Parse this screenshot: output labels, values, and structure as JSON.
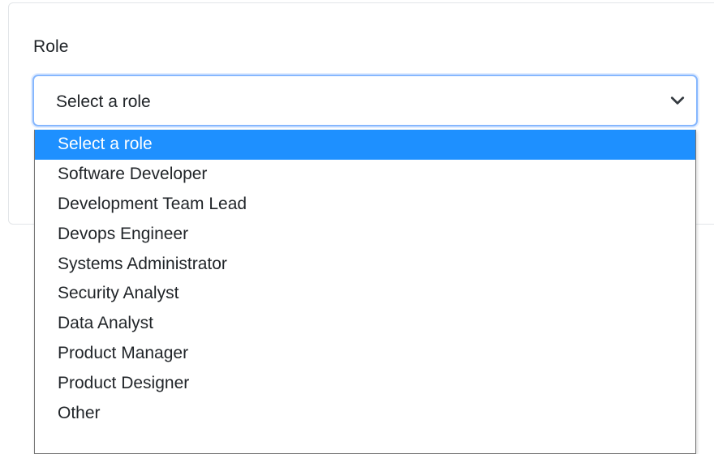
{
  "form": {
    "role_label": "Role",
    "role_select": {
      "selected_value": "Select a role",
      "caret_icon": "chevron-down-icon",
      "options": [
        "Select a role",
        "Software Developer",
        "Development Team Lead",
        "Devops Engineer",
        "Systems Administrator",
        "Security Analyst",
        "Data Analyst",
        "Product Manager",
        "Product Designer",
        "Other"
      ],
      "highlighted_index": 0
    }
  },
  "colors": {
    "focus_border": "#86b7fe",
    "option_highlight": "#1e90ff",
    "text": "#212529"
  }
}
